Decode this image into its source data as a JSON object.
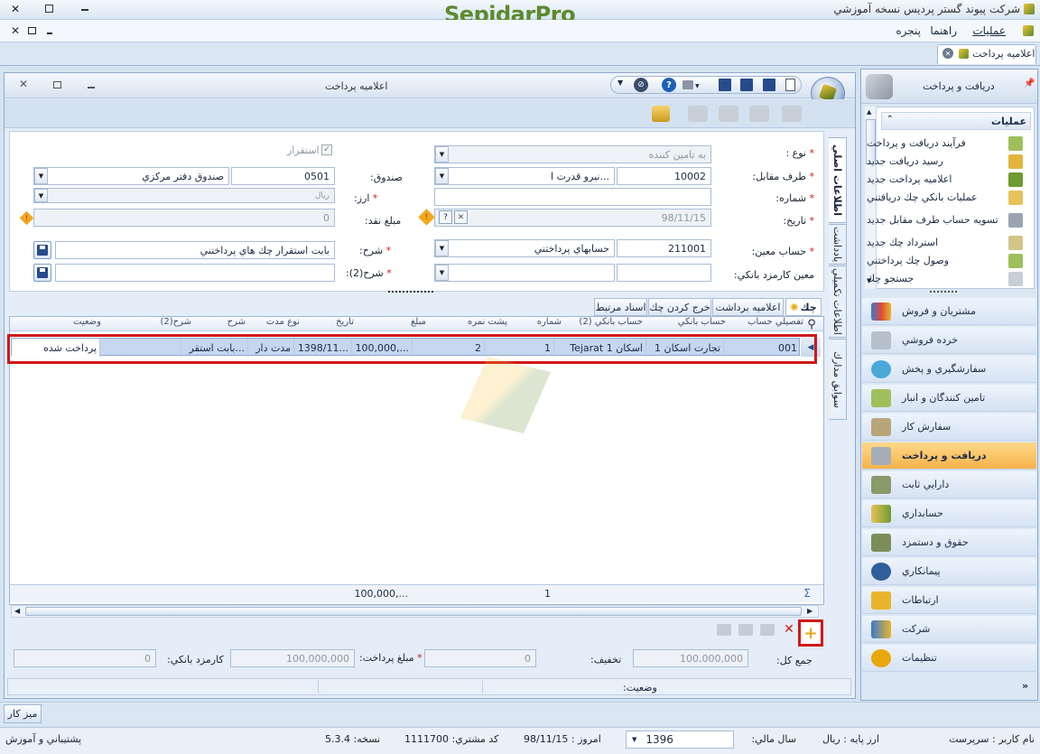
{
  "app": {
    "title": "شركت پيوند گستر پرديس نسخه آموزشي",
    "brand": "SepidarPro",
    "menu": [
      "عمليات",
      "راهنما",
      "پنجره"
    ],
    "doc_tab": "اعلاميه پرداخت"
  },
  "window": {
    "title": "اعلاميه پرداخت"
  },
  "form": {
    "type_label": "نوع :",
    "type_placeholder": "به تامين كننده",
    "confirm_label": "استقرار",
    "counterparty_label": "طرف مقابل:",
    "counterparty_code": "10002",
    "counterparty_name": "نيرو قدرت ا...",
    "fund_label": "صندوق:",
    "fund_code": "0501",
    "fund_name": "صندوق دفتر مركزي",
    "number_label": "شماره:",
    "currency_label": "ارز:",
    "currency_value": "ريال",
    "date_label": "تاريخ:",
    "date_value": "98/11/15",
    "cash_label": "مبلغ نقد:",
    "cash_value": "0",
    "account_label": "حساب معين:",
    "account_code": "211001",
    "account_name": "حسابهاي پرداختني",
    "desc_label": "شرح:",
    "desc_value": "بابت استقرار چك هاي پرداختني",
    "fee_account_label": "معين كارمزد بانكي:",
    "desc2_label": "شرح(2):"
  },
  "side_tabs": [
    "اطلاعات اصلي",
    "اطلاعات تكميلي",
    "يادداشت",
    "سوابق مدارك"
  ],
  "bottom_tabs": {
    "check": "چك",
    "notice": "اعلاميه برداشت",
    "out_check": "خرج كردن چك",
    "related": "اسناد مرتبط"
  },
  "grid": {
    "headers": [
      "تفصيلي حساب",
      "حساب بانكي",
      "حساب بانكي (2)",
      "شماره",
      "پشت نمره",
      "مبلغ",
      "تاريخ",
      "نوع مدت",
      "شرح",
      "شرح(2)",
      "وضعيت"
    ],
    "row": {
      "detail": "001",
      "bank": "تجارت اسكان 1",
      "bank2": "Tejarat اسكان 1",
      "number": "1",
      "serial": "2",
      "amount": "100,000,...",
      "date": "1398/11...",
      "term": "مدت دار",
      "desc": "بابت استقر...",
      "status": "پرداخت شده"
    },
    "footer": {
      "sigma": "Σ",
      "count": "1",
      "sum": "100,000,..."
    }
  },
  "totals": {
    "total_label": "جمع كل:",
    "total_value": "100,000,000",
    "discount_label": "تخفيف:",
    "discount_value": "0",
    "payment_label": "مبلغ پرداخت:",
    "payment_value": "100,000,000",
    "fee_label": "كارمزد بانكي:",
    "fee_value": "0",
    "status_label": "وضعيت:"
  },
  "nav": {
    "header": "دريافت و پرداخت",
    "ops_title": "عمليات",
    "ops": [
      "فرآيند دريافت و پرداخت",
      "رسيد دريافت جديد",
      "اعلاميه پرداخت جديد",
      "عمليات بانكي چك دريافتني",
      "تسويه حساب طرف مقابل جديد",
      "استرداد چك جديد",
      "وصول چك پرداختني",
      "جستجو چك"
    ],
    "modules": [
      "مشتريان و فروش",
      "خرده فروشي",
      "سفارشگيري و پخش",
      "تامين كنندگان و انبار",
      "سفارش كار",
      "دريافت و پرداخت",
      "دارايي ثابت",
      "حسابداري",
      "حقوق و دستمزد",
      "پيمانكاري",
      "ارتباطات",
      "شركت",
      "تنظيمات"
    ]
  },
  "taskbar": {
    "desk": "ميز كار"
  },
  "status": {
    "user_label": "نام كاربر :",
    "user": "سرپرست",
    "base_currency_label": "ارز پايه :",
    "base_currency": "ريال",
    "fiscal_year_label": "سال مالي:",
    "fiscal_year": "1396",
    "today_label": "امروز :",
    "today": "98/11/15",
    "customer_code_label": "كد مشتري:",
    "customer_code": "1111700",
    "version_label": "نسخه:",
    "version": "5.3.4",
    "support": "پشتيباني و آموزش"
  },
  "colors": {
    "highlight": "#d01818",
    "active_module": "#f6b24a",
    "brand_green": "#5d8a2e"
  }
}
